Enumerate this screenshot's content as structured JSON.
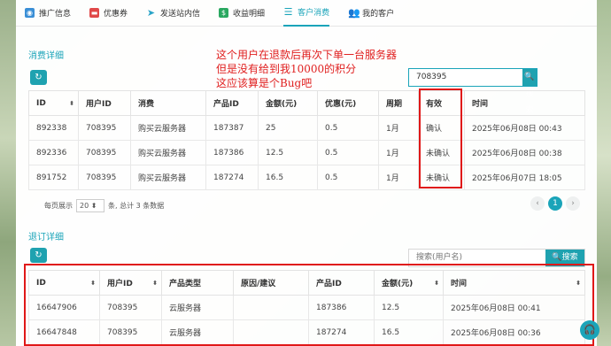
{
  "tabs": [
    {
      "label": "推广信息",
      "icon": "user-icon",
      "color": "#3a8fd6"
    },
    {
      "label": "优惠券",
      "icon": "coupon-icon",
      "color": "#e04848"
    },
    {
      "label": "发送站内信",
      "icon": "send-icon",
      "color": "#2aa4c8"
    },
    {
      "label": "收益明细",
      "icon": "money-icon",
      "color": "#2aa860"
    },
    {
      "label": "客户消费",
      "icon": "list-icon",
      "color": "#1aa4b9"
    },
    {
      "label": "我的客户",
      "icon": "users-icon",
      "color": "#3a8fd6"
    }
  ],
  "consumption": {
    "title": "消费详细",
    "search_value": "708395",
    "search_button": "搜索",
    "headers": [
      "ID",
      "用户ID",
      "消费",
      "产品ID",
      "金额(元)",
      "优惠(元)",
      "周期",
      "有效",
      "时间"
    ],
    "rows": [
      [
        "892338",
        "708395",
        "购买云服务器",
        "187387",
        "25",
        "0.5",
        "1月",
        "确认",
        "2025年06月08日 00:43"
      ],
      [
        "892336",
        "708395",
        "购买云服务器",
        "187386",
        "12.5",
        "0.5",
        "1月",
        "未确认",
        "2025年06月08日 00:38"
      ],
      [
        "891752",
        "708395",
        "购买云服务器",
        "187274",
        "16.5",
        "0.5",
        "1月",
        "未确认",
        "2025年06月07日 18:05"
      ]
    ],
    "pager": {
      "prefix": "每页展示",
      "page_size": "20",
      "suffix": "条, 总计 3 条数据",
      "current_page": "1"
    }
  },
  "refund": {
    "title": "退订详细",
    "search_placeholder": "搜索(用户名)",
    "search_button": "搜索",
    "headers": [
      "ID",
      "用户ID",
      "产品类型",
      "原因/建议",
      "产品ID",
      "金额(元)",
      "时间"
    ],
    "rows": [
      [
        "16647906",
        "708395",
        "云服务器",
        "",
        "187386",
        "12.5",
        "2025年06月08日 00:41"
      ],
      [
        "16647848",
        "708395",
        "云服务器",
        "",
        "187274",
        "16.5",
        "2025年06月08日 00:36"
      ]
    ]
  },
  "annotation": {
    "line1": "这个用户在退款后再次下单一台服务器",
    "line2": "但是没有给到我10000的积分",
    "line3": "这应该算是个Bug吧"
  },
  "colors": {
    "accent": "#1aa4b9",
    "annotation": "#e02020"
  }
}
